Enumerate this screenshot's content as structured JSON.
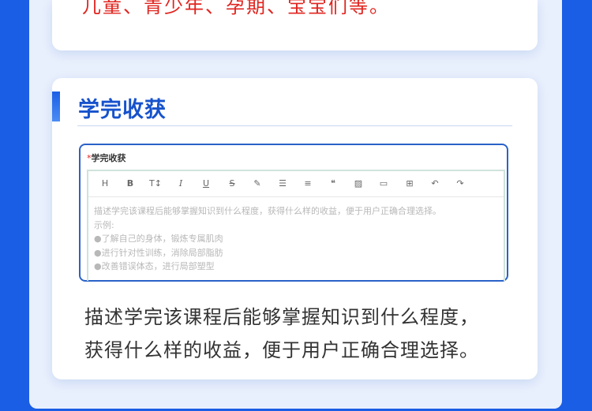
{
  "top_card": {
    "text": "儿童、青少年、孕期、宝宝们等。"
  },
  "section": {
    "title": "学完收获",
    "field_label": "学完收获",
    "required_mark": "*",
    "toolbar": [
      {
        "name": "heading-icon",
        "glyph": "H"
      },
      {
        "name": "bold-icon",
        "glyph": "B"
      },
      {
        "name": "font-size-icon",
        "glyph": "T↕"
      },
      {
        "name": "italic-icon",
        "glyph": "I"
      },
      {
        "name": "underline-icon",
        "glyph": "U"
      },
      {
        "name": "strikethrough-icon",
        "glyph": "S"
      },
      {
        "name": "highlight-icon",
        "glyph": "✎"
      },
      {
        "name": "bullet-list-icon",
        "glyph": "☰"
      },
      {
        "name": "align-icon",
        "glyph": "≡"
      },
      {
        "name": "quote-icon",
        "glyph": "❝"
      },
      {
        "name": "image-icon",
        "glyph": "▨"
      },
      {
        "name": "file-icon",
        "glyph": "▭"
      },
      {
        "name": "table-icon",
        "glyph": "⊞"
      },
      {
        "name": "undo-icon",
        "glyph": "↶"
      },
      {
        "name": "redo-icon",
        "glyph": "↷"
      }
    ],
    "placeholder_lines": [
      "描述学完该课程后能够掌握知识到什么程度，获得什么样的收益，便于用户正确合理选择。",
      "示例:",
      "●了解自己的身体，锻炼专属肌肉",
      "●进行针对性训练，消除局部脂肪",
      "●改善错误体态，进行局部塑型"
    ],
    "description_lines": [
      "描述学完该课程后能够掌握知识到什么程度，",
      "获得什么样的收益，便于用户正确合理选择。"
    ]
  }
}
